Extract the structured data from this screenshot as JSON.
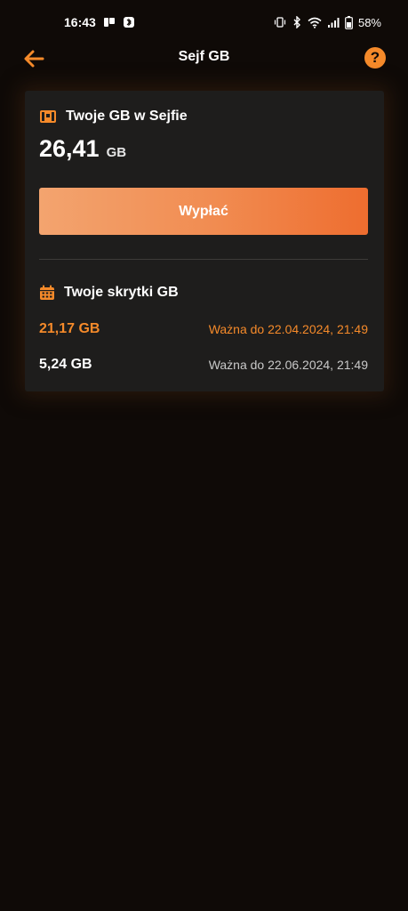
{
  "status_bar": {
    "time": "16:43",
    "battery": "58%",
    "icons_left": [
      "notification-icon",
      "bluetooth-notification-icon"
    ],
    "icons_right": [
      "vibrate-icon",
      "bluetooth-icon",
      "wifi-icon",
      "signal-icon",
      "battery-icon"
    ]
  },
  "header": {
    "title": "Sejf GB",
    "help_label": "?"
  },
  "safe": {
    "label": "Twoje GB w Sejfie",
    "amount": "26,41",
    "unit": "GB",
    "withdraw_label": "Wypłać"
  },
  "lockers": {
    "label": "Twoje skrytki GB",
    "items": [
      {
        "amount": "21,17 GB",
        "expiry": "Ważna do 22.04.2024, 21:49",
        "highlight": true
      },
      {
        "amount": "5,24 GB",
        "expiry": "Ważna do 22.06.2024, 21:49",
        "highlight": false
      }
    ]
  },
  "colors": {
    "accent": "#f58a2a",
    "background": "#0f0a07",
    "card": "#1e1d1c",
    "button_gradient_start": "#f3a46f",
    "button_gradient_end": "#ee6d2f"
  }
}
